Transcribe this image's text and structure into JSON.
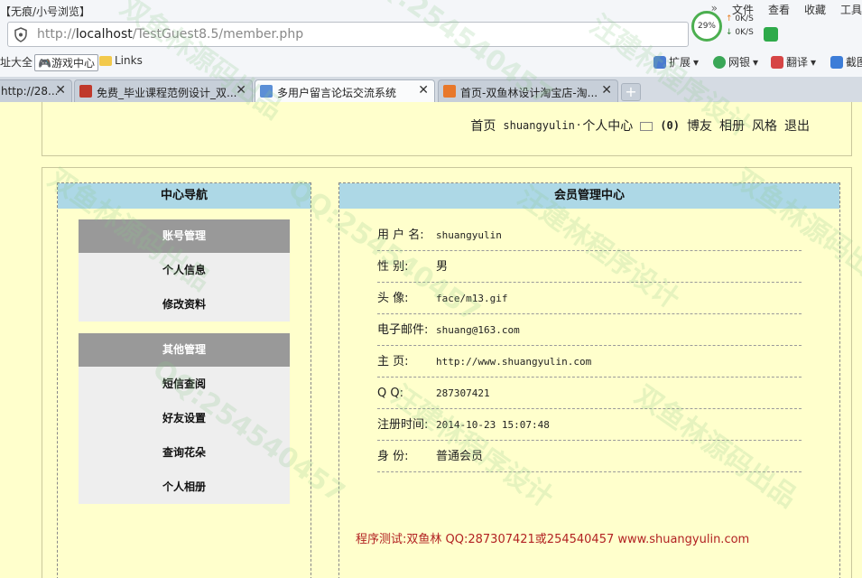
{
  "browser": {
    "window_title": "【无痕/小号浏览】",
    "top_menu": [
      "»",
      "文件",
      "查看",
      "收藏",
      "工具"
    ],
    "url_prefix": "http://",
    "url_host": "localhost",
    "url_path": "/TestGuest8.5/member.php",
    "net": {
      "percent": "29%",
      "up": "0K/S",
      "down": "0K/S"
    },
    "favorites": {
      "left_cut": "址大全",
      "games": "游戏中心",
      "links": "Links",
      "extensions": "扩展",
      "netbank": "网银",
      "translate": "翻译",
      "screenshot": "截图"
    },
    "tabs": [
      {
        "label": "http://28...",
        "active": false
      },
      {
        "label": "免费_毕业课程范例设计_双...",
        "active": false
      },
      {
        "label": "多用户留言论坛交流系统",
        "active": true
      },
      {
        "label": "首页-双鱼林设计淘宝店-淘...",
        "active": false
      }
    ],
    "close_glyph": "✕",
    "new_tab_glyph": "+"
  },
  "header": {
    "home": "首页",
    "username": "shuangyulin",
    "separator": "·",
    "center": "个人中心",
    "msg_count": "(0)",
    "friends": "博友",
    "album": "相册",
    "style": "风格",
    "logout": "退出"
  },
  "sidebar": {
    "title": "中心导航",
    "groups": [
      {
        "title": "账号管理",
        "items": [
          "个人信息",
          "修改资料"
        ]
      },
      {
        "title": "其他管理",
        "items": [
          "短信查阅",
          "好友设置",
          "查询花朵",
          "个人相册"
        ]
      }
    ]
  },
  "member": {
    "title": "会员管理中心",
    "rows": [
      {
        "label": "用 户 名:",
        "value": "shuangyulin"
      },
      {
        "label": "性    别:",
        "value": "男"
      },
      {
        "label": "头    像:",
        "value": "face/m13.gif"
      },
      {
        "label": "电子邮件:",
        "value": "shuang@163.com"
      },
      {
        "label": "主    页:",
        "value": "http://www.shuangyulin.com"
      },
      {
        "label": "Q      Q:",
        "value": "287307421"
      },
      {
        "label": "注册时间:",
        "value": "2014-10-23 15:07:48"
      },
      {
        "label": "身    份:",
        "value": "普通会员"
      }
    ],
    "credit": "程序测试:双鱼林 QQ:287307421或254540457 www.shuangyulin.com"
  },
  "watermarks": [
    "双鱼林源码出品",
    "QQ:254540457",
    "汪建林程序设计"
  ],
  "colors": {
    "page_bg": "#ffffcc",
    "panel_head": "#add8e6",
    "menu_head": "#999999",
    "menu_bg": "#eeeeee",
    "credit": "#b22222"
  }
}
